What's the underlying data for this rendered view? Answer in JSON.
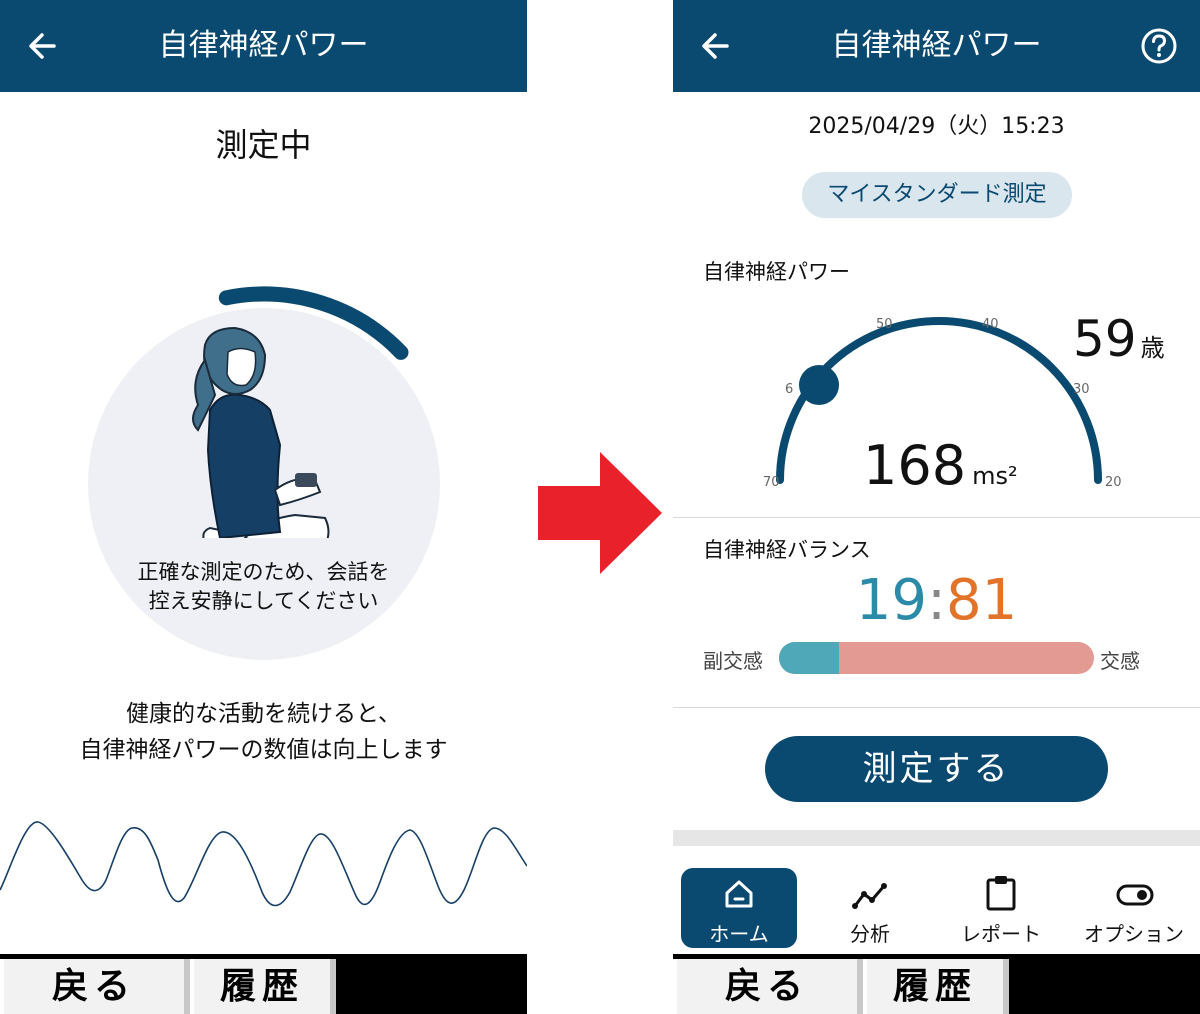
{
  "left_screen": {
    "header": {
      "title": "自律神経パワー"
    },
    "status": "測定中",
    "measurement_progress": 0.16,
    "notice": {
      "line1": "正確な測定のため、会話を",
      "line2": "控え安静にしてください"
    },
    "tip": {
      "line1": "健康的な活動を続けると、",
      "line2": "自律神経パワーの数値は向上します"
    },
    "hardware_buttons": {
      "back": "戻る",
      "history": "履歴"
    }
  },
  "arrow": {
    "color": "#e8212a"
  },
  "right_screen": {
    "header": {
      "title": "自律神経パワー"
    },
    "datetime": "2025/04/29（火）15:23",
    "mode_badge": "マイスタンダード測定",
    "power": {
      "section_title": "自律神経パワー",
      "value": "168",
      "unit": "ms²",
      "age_value": "59",
      "age_unit": "歳",
      "gauge_age": 62,
      "gauge_ticks": [
        "70",
        "6",
        "50",
        "40",
        "30",
        "20"
      ]
    },
    "balance": {
      "section_title": "自律神経バランス",
      "parasympathetic": 19,
      "sympathetic": 81,
      "parasympathetic_text": "19",
      "sympathetic_text": "81",
      "separator": ":",
      "left_label": "副交感",
      "right_label": "交感"
    },
    "measure_button": "測定する",
    "bottom_nav": [
      {
        "label": "ホーム",
        "icon": "home-icon",
        "active": true
      },
      {
        "label": "分析",
        "icon": "analysis-chart-icon",
        "active": false
      },
      {
        "label": "レポート",
        "icon": "clipboard-icon",
        "active": false
      },
      {
        "label": "オプション",
        "icon": "toggle-icon",
        "active": false
      }
    ],
    "hardware_buttons": {
      "back": "戻る",
      "history": "履歴"
    }
  },
  "colors": {
    "navy": "#0b4a70",
    "parasympathetic": "#2a8aa8",
    "sympathetic": "#e2742a",
    "balance_left_bar": "#4ea8b8",
    "balance_right_bar": "#e29a92"
  }
}
